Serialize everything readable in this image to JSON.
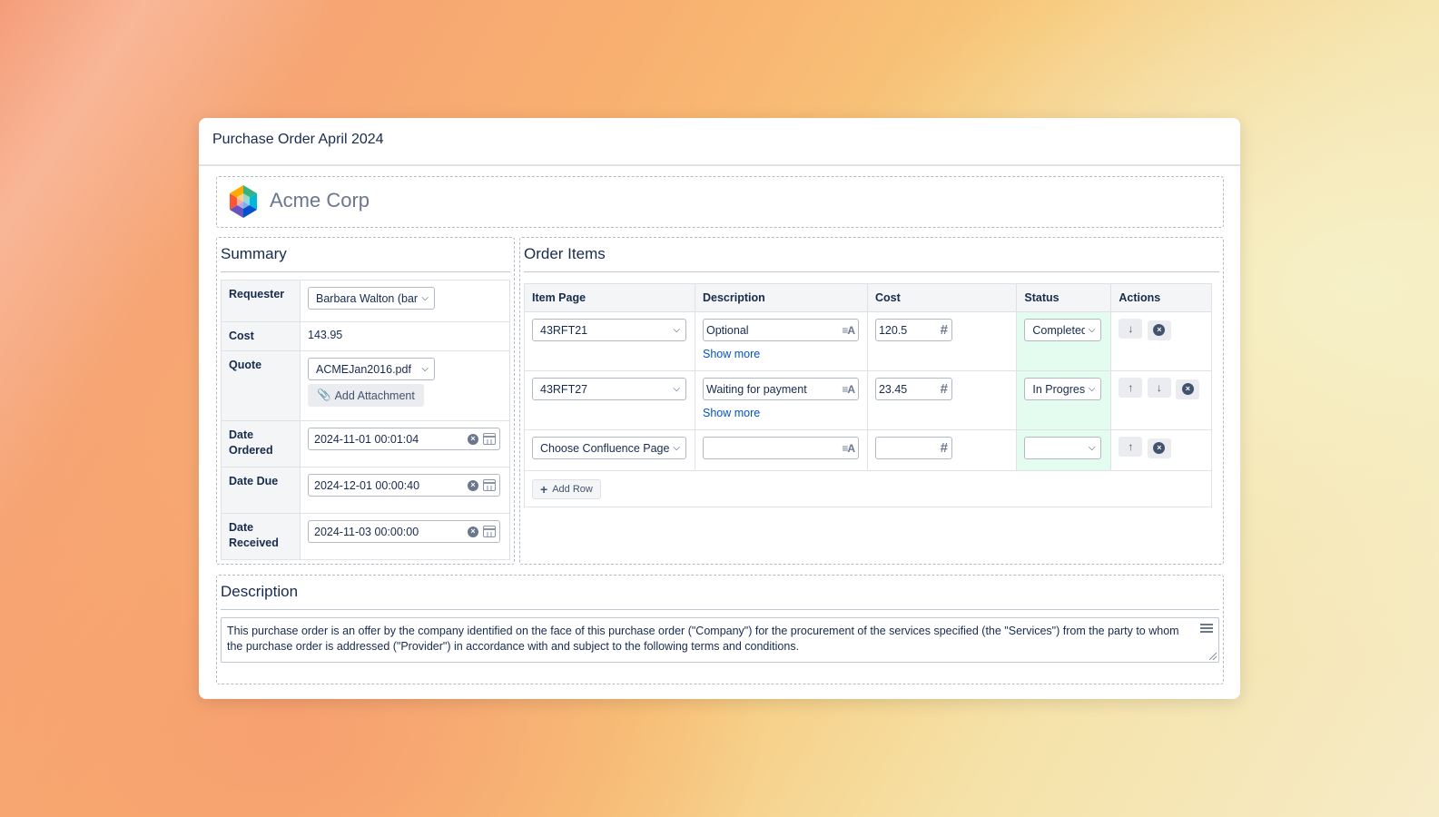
{
  "page": {
    "title": "Purchase Order April 2024"
  },
  "brand": {
    "name": "Acme Corp",
    "logo_icon": "hexagon-cube-logo"
  },
  "summary": {
    "title": "Summary",
    "requester": {
      "label": "Requester",
      "value": "Barbara Walton (bart"
    },
    "cost": {
      "label": "Cost",
      "value": "143.95"
    },
    "quote": {
      "label": "Quote",
      "value": "ACMEJan2016.pdf",
      "add_attachment": "Add Attachment"
    },
    "date_ordered": {
      "label": "Date Ordered",
      "value": "2024-11-01 00:01:04"
    },
    "date_due": {
      "label": "Date Due",
      "value": "2024-12-01 00:00:40"
    },
    "date_received": {
      "label": "Date Received",
      "value": "2024-11-03 00:00:00"
    }
  },
  "orders": {
    "title": "Order Items",
    "columns": [
      "Item Page",
      "Description",
      "Cost",
      "Status",
      "Actions"
    ],
    "rows": [
      {
        "item": "43RFT21",
        "description": "Optional",
        "show_more": "Show more",
        "cost": "120.5",
        "status": "Completed"
      },
      {
        "item": "43RFT27",
        "description": "Waiting for payment",
        "show_more": "Show more",
        "cost": "23.45",
        "status": "In Progress"
      },
      {
        "item": "Choose Confluence Page",
        "description": "",
        "cost": "",
        "status": ""
      }
    ],
    "add_row": "Add Row",
    "status_color": "#e3fcef"
  },
  "description": {
    "title": "Description",
    "text": "This purchase order is an offer by the company identified on the face of this purchase order (\"Company\") for the procurement of the services specified (the \"Services\") from the party to whom the purchase order is addressed (\"Provider\") in accordance with and subject to the following terms and conditions."
  }
}
